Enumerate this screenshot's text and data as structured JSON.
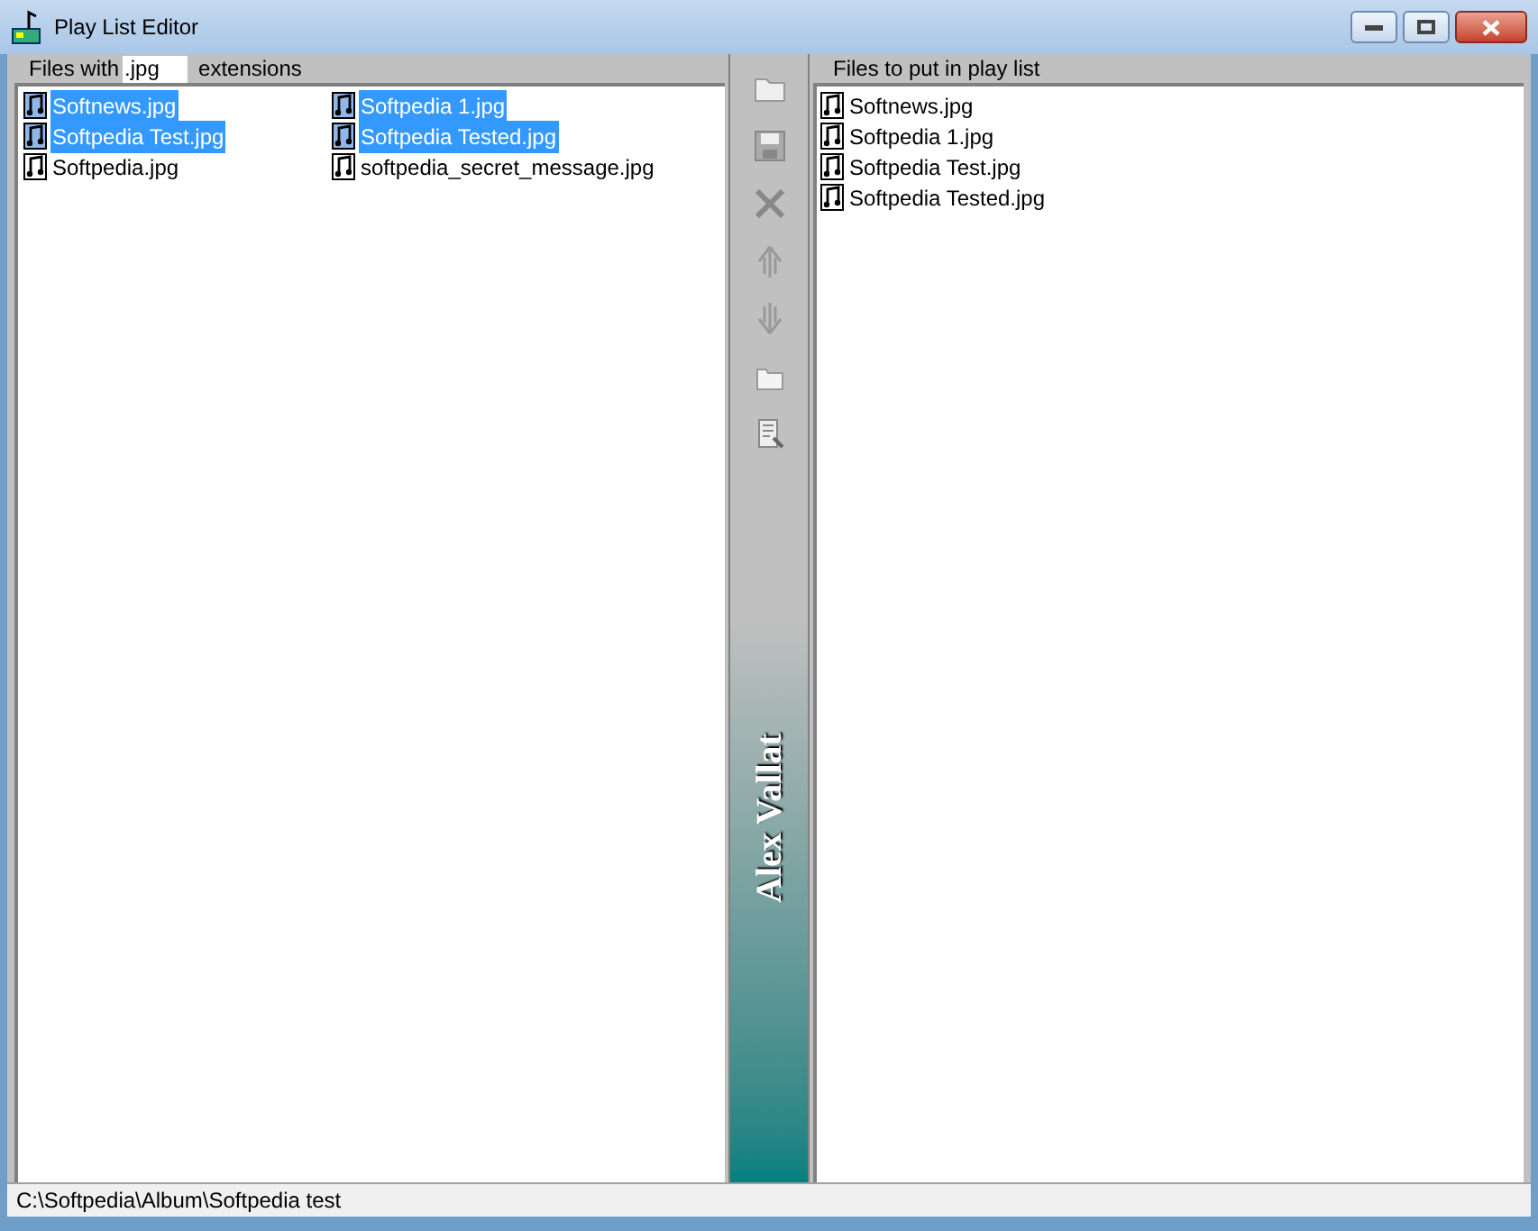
{
  "window": {
    "title": "Play List Editor"
  },
  "filter": {
    "prefix": "Files with",
    "value": ".jpg",
    "suffix": "extensions"
  },
  "files": [
    {
      "name": "Softnews.jpg",
      "selected": true
    },
    {
      "name": "Softpedia Test.jpg",
      "selected": true
    },
    {
      "name": "Softpedia.jpg",
      "selected": false
    },
    {
      "name": "Softpedia 1.jpg",
      "selected": true
    },
    {
      "name": "Softpedia Tested.jpg",
      "selected": true
    },
    {
      "name": "softpedia_secret_message.jpg",
      "selected": false
    }
  ],
  "toolbar": {
    "author": "Alex Vallat"
  },
  "playlist": {
    "title": "Files to put in play list",
    "items": [
      "Softnews.jpg",
      "Softpedia 1.jpg",
      "Softpedia Test.jpg",
      "Softpedia Tested.jpg"
    ]
  },
  "status_bar": "C:\\Softpedia\\Album\\Softpedia test"
}
